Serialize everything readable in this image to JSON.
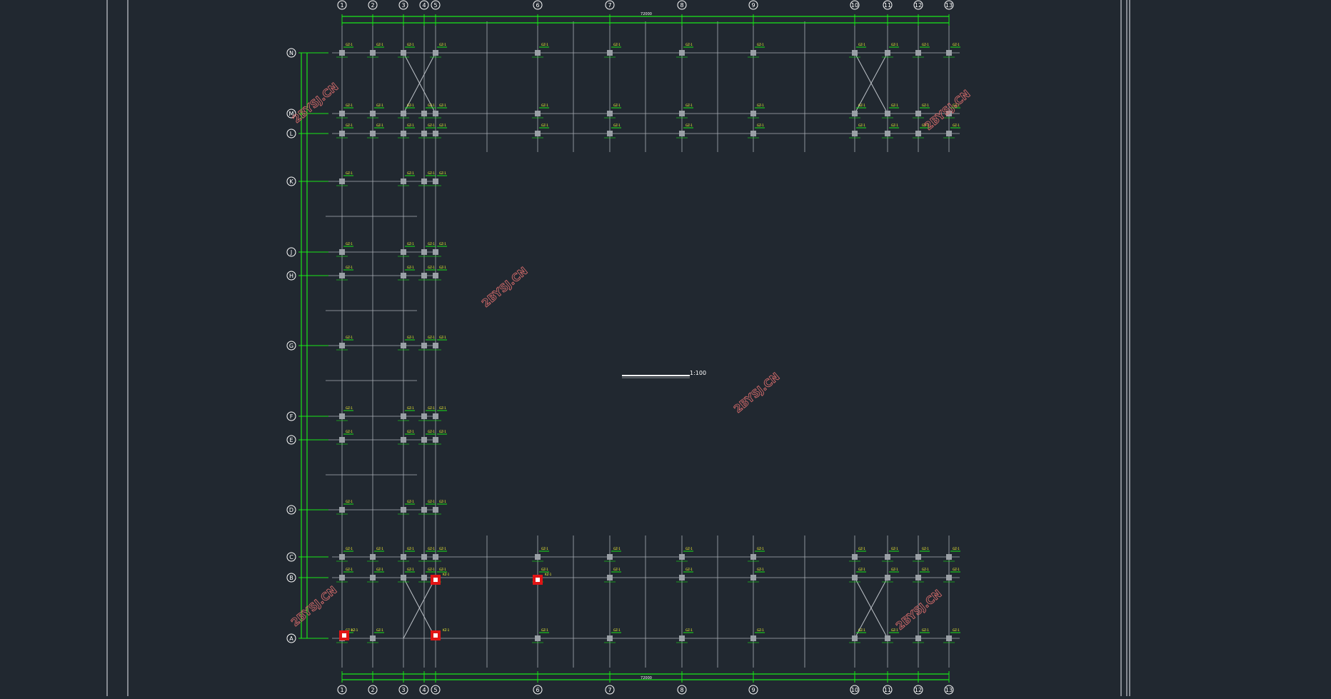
{
  "drawing": {
    "title": "",
    "scale": "1:100",
    "overall_dimension": "72000",
    "watermark": "2BYSJ.CN",
    "colors": {
      "background": "#212830",
      "frame": "#c8ccd2",
      "grid": "#a9aeb6",
      "dimension": "#19e619",
      "column": "#9aa0a6",
      "label": "#ffff33",
      "highlight": "#e01515",
      "watermark": "#d26a6a",
      "text": "#ffffff"
    }
  },
  "axes": {
    "columns": [
      "1",
      "2",
      "3",
      "4",
      "5",
      "6",
      "7",
      "8",
      "9",
      "10",
      "11",
      "12",
      "13"
    ],
    "rows": [
      "N",
      "M",
      "L",
      "K",
      "J",
      "H",
      "G",
      "F",
      "E",
      "D",
      "C",
      "B",
      "A"
    ]
  },
  "column_tag": "GZ-1",
  "highlight_tag": "KZ-1"
}
